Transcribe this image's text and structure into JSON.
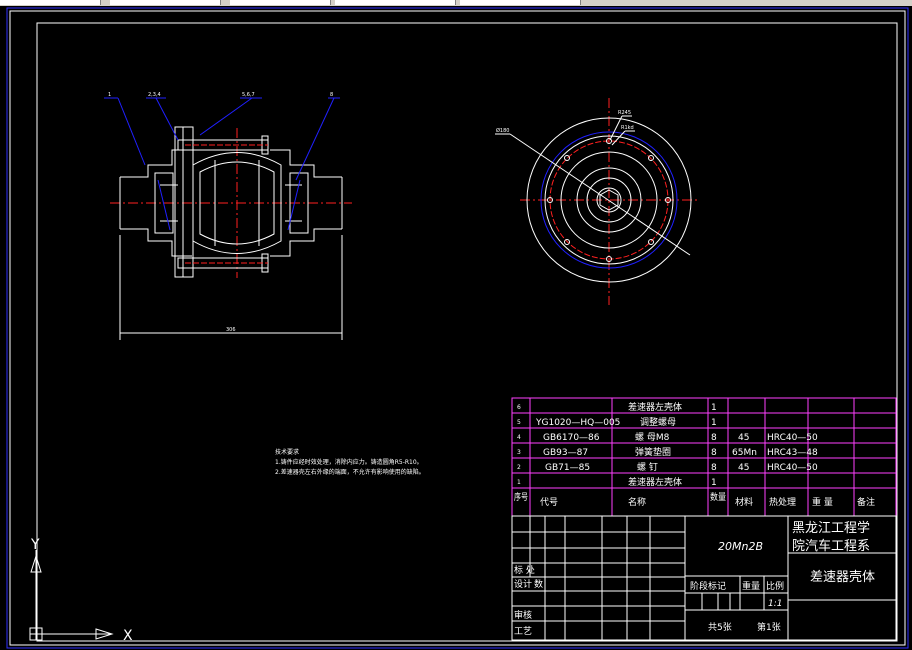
{
  "drawing": {
    "dimensions": {
      "overall_length": "306",
      "diameter_main": "Ø180",
      "radius_1": "R245",
      "radius_2": "R1kd"
    },
    "balloons": [
      "1",
      "2,3,4",
      "5,6,7",
      "8"
    ],
    "technical_requirements": {
      "heading": "技术要求",
      "items": [
        "1.铸件应经时效处理，消除内应力。铸造圆角R5-R10。",
        "2.差速器壳左右外缘的端面，不允许有影响使用的缺陷。"
      ]
    }
  },
  "bom": {
    "rows": [
      {
        "no": "6",
        "code": "",
        "name": "差速器左壳体",
        "qty": "1",
        "material": "",
        "heat": ""
      },
      {
        "no": "5",
        "code": "YG1020—HQ—005",
        "name": "调整螺母",
        "qty": "1",
        "material": "",
        "heat": ""
      },
      {
        "no": "4",
        "code": "GB6170—86",
        "name": "螺    母M8",
        "qty": "8",
        "material": "45",
        "heat": "HRC40—50"
      },
      {
        "no": "3",
        "code": "GB93—87",
        "name": "弹簧垫圈",
        "qty": "8",
        "material": "65Mn",
        "heat": "HRC43—48"
      },
      {
        "no": "2",
        "code": "GB71—85",
        "name": "螺    钉",
        "qty": "8",
        "material": "45",
        "heat": "HRC40—50"
      },
      {
        "no": "1",
        "code": "",
        "name": "差速器左壳体",
        "qty": "1",
        "material": "",
        "heat": ""
      }
    ],
    "header": {
      "no": "序号",
      "code": "代号",
      "name": "名称",
      "qty": "数量",
      "material": "材料",
      "heat": "热处理",
      "weight": "重  量",
      "note": "备注"
    }
  },
  "title_block": {
    "material": "20Mn2B",
    "org_line1": "黑龙江工程学",
    "org_line2": "院汽车工程系",
    "drawing_title": "差速器壳体",
    "biaochu": "标  处",
    "sheji": "设计",
    "shu": "数",
    "shenhe": "审核",
    "gongyi": "工艺",
    "stage_mark": "阶段标记",
    "weight": "重量",
    "scale_label": "比例",
    "scale": "1:1",
    "sheets": "共5张",
    "sheet_no": "第1张"
  },
  "ucs": {
    "y_label": "Y",
    "x_label": "X"
  },
  "colors": {
    "background": "#000000",
    "lines": "#ffffff",
    "centerline": "#ff2020",
    "hidden": "#2020ff",
    "table": "#ff40ff",
    "frame": "#3030ff"
  }
}
